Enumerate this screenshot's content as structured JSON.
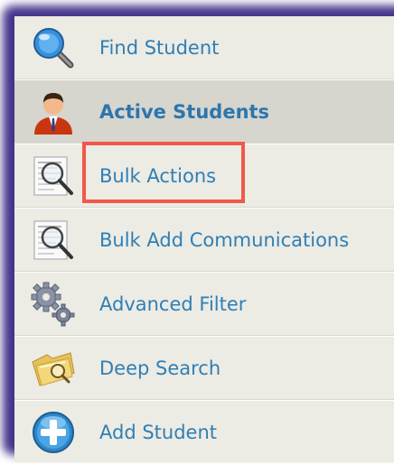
{
  "menu": {
    "items": [
      {
        "label": "Find Student",
        "icon": "magnifier-icon",
        "active": false
      },
      {
        "label": "Active Students",
        "icon": "user-icon",
        "active": true
      },
      {
        "label": "Bulk Actions",
        "icon": "document-search-icon",
        "active": false
      },
      {
        "label": "Bulk Add Communications",
        "icon": "document-search-icon",
        "active": false
      },
      {
        "label": "Advanced Filter",
        "icon": "gears-icon",
        "active": false
      },
      {
        "label": "Deep Search",
        "icon": "folder-search-icon",
        "active": false
      },
      {
        "label": "Add Student",
        "icon": "plus-circle-icon",
        "active": false
      }
    ]
  },
  "highlight": {
    "target": "Bulk Actions",
    "color": "#f2584a"
  },
  "colors": {
    "link": "#2f7fb5",
    "menu_background": "#ecebe4",
    "active_background": "#d6d5ce",
    "frame_shadow": "#3d2a86"
  }
}
